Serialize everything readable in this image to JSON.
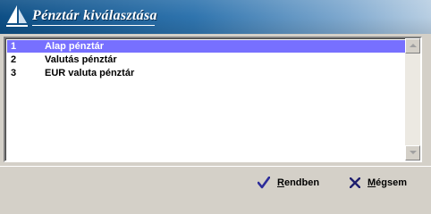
{
  "window": {
    "title": "Pénztár kiválasztása"
  },
  "list": {
    "selected_index": 0,
    "items": [
      {
        "num": "1",
        "name": "Alap pénztár"
      },
      {
        "num": "2",
        "name": "Valutás pénztár"
      },
      {
        "num": "3",
        "name": "EUR valuta pénztár"
      }
    ]
  },
  "buttons": {
    "ok": {
      "first_letter": "R",
      "rest": "endben",
      "icon": "check-icon"
    },
    "cancel": {
      "first_letter": "M",
      "rest": "égsem",
      "icon": "close-icon"
    }
  },
  "colors": {
    "selection": "#7770ff",
    "check": "#2c2c9a",
    "cancel_x": "#1e1e6e"
  }
}
